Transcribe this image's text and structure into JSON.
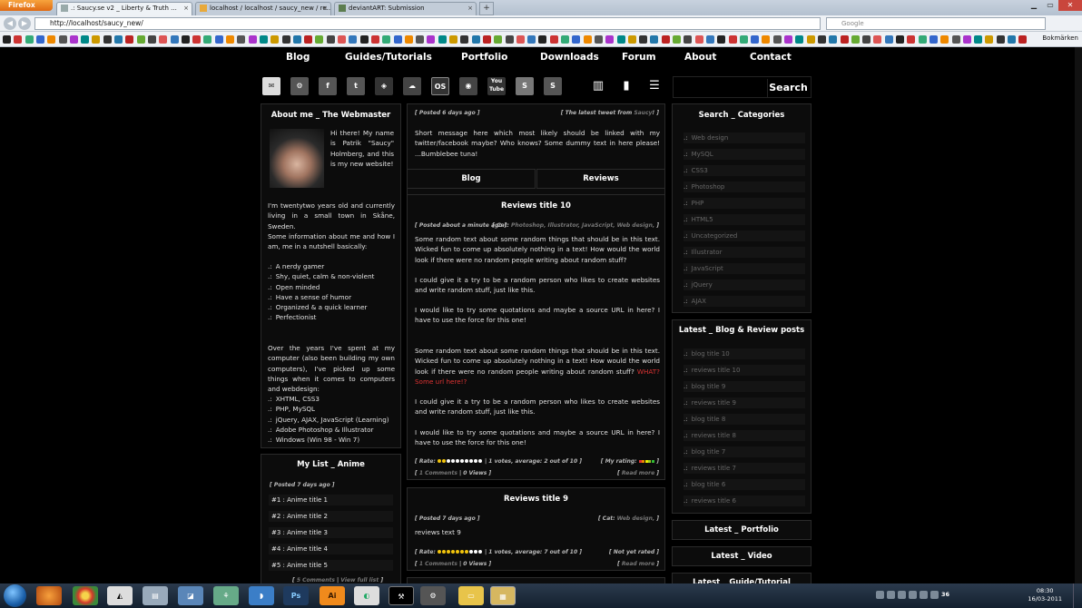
{
  "browser": {
    "firefox_label": "Firefox",
    "tabs": [
      {
        "label": ".: Saucy.se v2 _ Liberty & Truth ..."
      },
      {
        "label": "localhost / localhost / saucy_new / re..."
      },
      {
        "label": "deviantART: Submission"
      }
    ],
    "new_tab": "+",
    "url": "http://localhost/saucy_new/",
    "search_placeholder": "Google",
    "bookmarks_label": "Bokmärken"
  },
  "nav": {
    "items": [
      "Blog",
      "Guides/Tutorials",
      "Portfolio",
      "Downloads",
      "Forum",
      "About",
      "Contact"
    ]
  },
  "social": {
    "icons": [
      "mail-icon",
      "steam-icon",
      "facebook-icon",
      "twitter-icon",
      "inkscape-icon",
      "deviantart-icon",
      "os-icon",
      "gaming-icon",
      "youtube-icon",
      "skype-icon",
      "skype2-icon",
      "library-icon",
      "stats-icon",
      "list-icon"
    ],
    "youtube_label": "You Tube",
    "os_label": "OS",
    "s_label": "S"
  },
  "search_button": "Search",
  "about": {
    "title": "About me _ The Webmaster",
    "intro": "Hi there! My name is Patrik \"Saucy\" Holmberg, and this is my new website!",
    "p1": "I'm twentytwo years old and currently living in a small town in Skåne, Sweden.",
    "p2": "Some information about me and how I am, me in a nutshell basically:",
    "traits": [
      "A nerdy gamer",
      "Shy, quiet, calm & non-violent",
      "Open minded",
      "Have a sense of humor",
      "Organized & a quick learner",
      "Perfectionist"
    ],
    "p3": "Over the years I've spent at my computer (also been building my own computers), I've picked up some things when it comes to computers and webdesign:",
    "skills": [
      "XHTML, CSS3",
      "PHP, MySQL",
      "jQuery, AJAX, JavaScript (Learning)",
      "Adobe Photoshop & Illustrator",
      "Windows (Win 98 - Win 7)"
    ]
  },
  "mylist": {
    "title": "My List _ Anime",
    "posted": "[ Posted 7 days ago ]",
    "items": [
      "#1 : Anime title 1",
      "#2 : Anime title 2",
      "#3 : Anime title 3",
      "#4 : Anime title 4",
      "#5 : Anime title 5"
    ],
    "comments": "5 Comments",
    "view_full": "View full list"
  },
  "tweet": {
    "posted": "[ Posted 6 days ago ]",
    "latest": "[ The latest tweet from",
    "source": "Saucy",
    "latest_end": "! ]",
    "text": "Short message here which most likely should be linked with my twitter/facebook maybe? Who knows? Some dummy text in here please! ...Bumblebee tuna!"
  },
  "tabs": {
    "blog": "Blog",
    "reviews": "Reviews"
  },
  "review1": {
    "title": "Reviews title 10",
    "posted": "[ Posted about a minute ago ]",
    "cat_label": "[ Cat:",
    "cats": "Photoshop, Illustrator, JavaScript, Web design,",
    "cat_end": "]",
    "para1": "Some random text about some random things that should be in this text. Wicked fun to come up absolutely nothing in a text! How would the world look if there were no random people writing about random stuff?",
    "para2": "I could give it a try to be a random person who likes to create websites and write random stuff, just like this.",
    "para3": "I would like to try some quotations and maybe a source URL in here? I have to use the force for this one!",
    "para4": "Some random text about some random things that should be in this text. Wicked fun to come up absolutely nothing in a text! How would the world look if there were no random people writing about random stuff?",
    "link": "WHAT? Some url here!?",
    "para5": "I could give it a try to be a random person who likes to create websites and write random stuff, just like this.",
    "para6": "I would like to try some quotations and maybe a source URL in here? I have to use the force for this one!",
    "rate_label": "[ Rate:",
    "stars_on": 2,
    "stars_total": 10,
    "votes": "| 1 votes, average: 2 out of 10 ]",
    "my_rating": "[ My rating:",
    "my_rating_end": "]",
    "comments": "1 Comments",
    "views": "0 Views",
    "read_more": "Read more"
  },
  "review2": {
    "title": "Reviews title 9",
    "posted": "[ Posted 7 days ago ]",
    "cat_label": "[ Cat:",
    "cats": "Web design,",
    "cat_end": "]",
    "text": "reviews text 9",
    "rate_label": "[ Rate:",
    "stars_on": 7,
    "stars_total": 10,
    "votes": "| 1 votes, average: 7 out of 10 ]",
    "not_rated": "[ Not yet rated ]",
    "comments": "1 Comments",
    "views": "0 Views",
    "read_more": "Read more"
  },
  "categories": {
    "title": "Search _ Categories",
    "items": [
      "Web design",
      "MySQL",
      "CSS3",
      "Photoshop",
      "PHP",
      "HTML5",
      "Uncategorized",
      "Illustrator",
      "JavaScript",
      "jQuery",
      "AJAX"
    ]
  },
  "latest_posts": {
    "title": "Latest _ Blog & Review posts",
    "items": [
      "blog title 10",
      "reviews title 10",
      "blog title 9",
      "reviews title 9",
      "blog title 8",
      "reviews title 8",
      "blog title 7",
      "reviews title 7",
      "blog title 6",
      "reviews title 6"
    ]
  },
  "sidebar_titles": {
    "portfolio": "Latest _ Portfolio",
    "video": "Latest _ Video",
    "guide": "Latest _ Guide/Tutorial"
  },
  "taskbar": {
    "time": "08:30",
    "date": "16/03-2011",
    "volume": "36",
    "ps_label": "Ps",
    "ai_label": "Ai"
  },
  "colors": {
    "accent_red": "#dd3333",
    "star_gold": "#f2c40c"
  }
}
